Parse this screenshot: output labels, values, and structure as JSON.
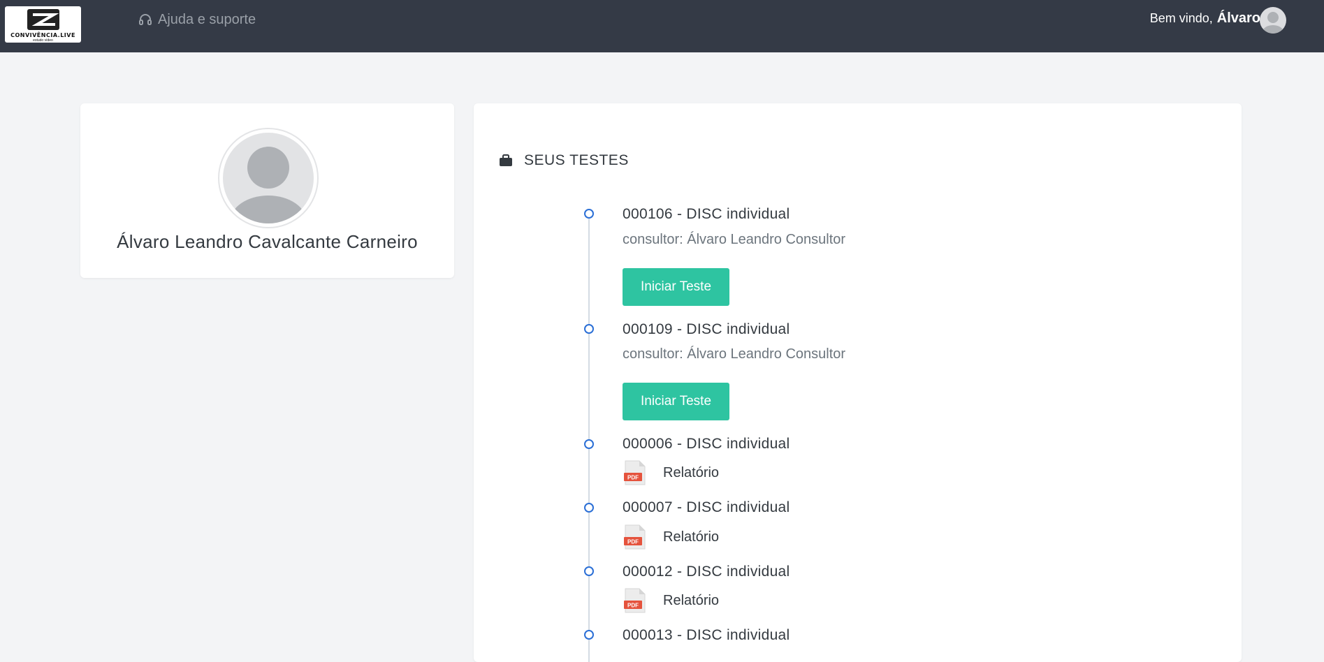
{
  "header": {
    "logo_text": "CONVIVÊNCIA.LIVE",
    "logo_sub": "estudo vídeo",
    "help_label": "Ajuda e suporte",
    "welcome_prefix": "Bem vindo,",
    "user_first_name": "Álvaro"
  },
  "profile": {
    "full_name": "Álvaro Leandro Cavalcante Carneiro"
  },
  "tests_section": {
    "title": "SEUS TESTES",
    "items": [
      {
        "title": "000106 - DISC individual",
        "consultant": "consultor: Álvaro Leandro Consultor",
        "action": "Iniciar Teste"
      },
      {
        "title": "000109 - DISC individual",
        "consultant": "consultor: Álvaro Leandro Consultor",
        "action": "Iniciar Teste"
      },
      {
        "title": "000006 - DISC individual",
        "report": "Relatório"
      },
      {
        "title": "000007 - DISC individual",
        "report": "Relatório"
      },
      {
        "title": "000012 - DISC individual",
        "report": "Relatório"
      },
      {
        "title": "000013 - DISC individual"
      }
    ]
  },
  "colors": {
    "navbar": "#343a46",
    "accent_button": "#2ec4a1",
    "timeline_dot": "#2b6fd6",
    "pdf_red": "#e5533d"
  }
}
